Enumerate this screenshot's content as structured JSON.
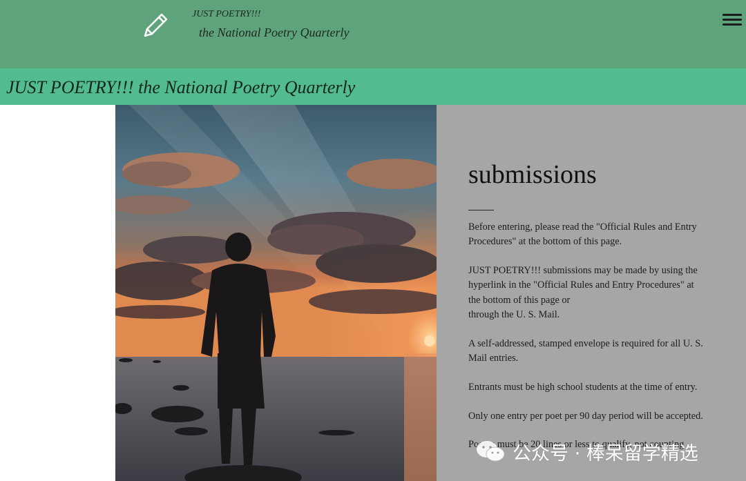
{
  "header": {
    "brand_line1": "JUST POETRY!!!",
    "brand_line2": "the National Poetry Quarterly",
    "logo_icon": "pencil-icon",
    "menu_icon": "hamburger-menu-icon"
  },
  "banner": {
    "title": "JUST POETRY!!! the National Poetry Quarterly"
  },
  "hero_image": {
    "subject": "silhouette-of-person-on-rock-at-sunset-by-sea"
  },
  "submissions": {
    "heading": "submissions",
    "paragraphs": [
      "Before entering, please read the \"Official Rules and Entry Procedures\" at the bottom of this page.",
      "JUST POETRY!!! submissions may be made by using the hyperlink in the \"Official Rules and Entry Procedures\" at the bottom of this page or",
      "through the U. S. Mail.",
      "A self-addressed, stamped envelope is required for all U. S. Mail entries.",
      "Entrants must be high school students at the time of entry.",
      "Only one entry per poet per 90 day period will be accepted.",
      "Poems must be 20 lines or less to qualify, not counting"
    ]
  },
  "watermark": {
    "text": "公众号 · 棒呆留学精选",
    "icon": "wechat-icon"
  },
  "colors": {
    "topbar": "#5ea37b",
    "banner": "#52bb8f",
    "panel": "#a6a6a6"
  }
}
